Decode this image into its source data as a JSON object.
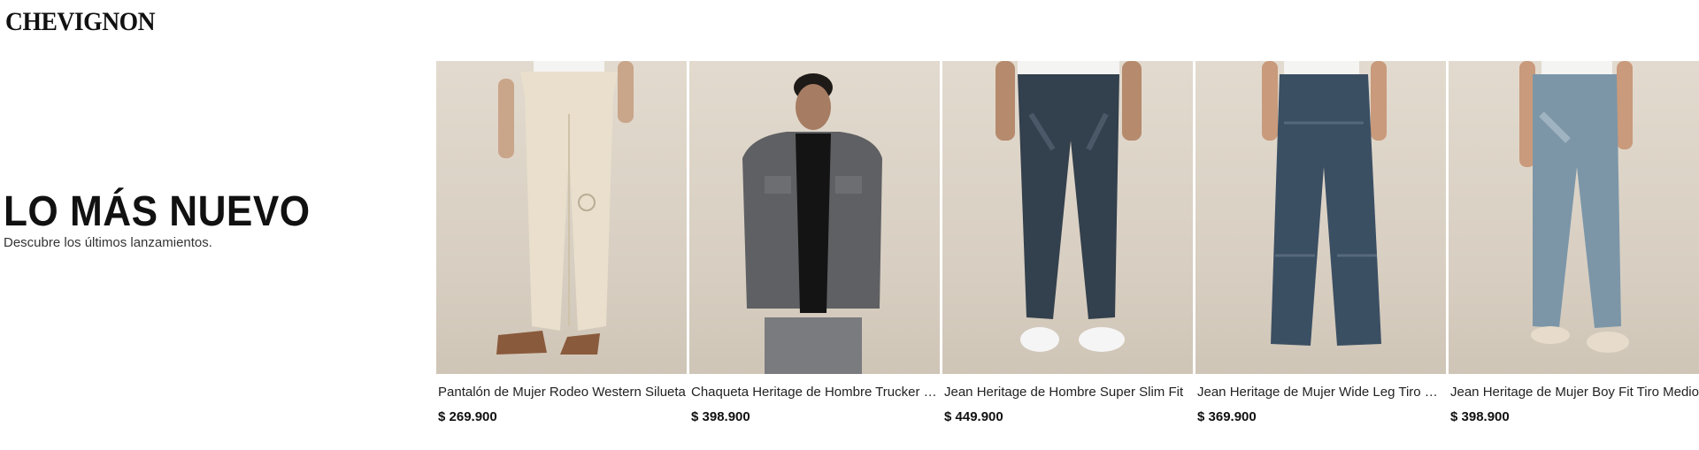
{
  "brand": {
    "logo_text": "CHEVIGNON"
  },
  "hero": {
    "title": "LO MÁS NUEVO",
    "subtitle": "Descubre los últimos lanzamientos."
  },
  "products": [
    {
      "name": "Pantalón de Mujer Rodeo Western Silueta",
      "price": "$ 269.900",
      "image": "beige-studded-pants-photo"
    },
    {
      "name": "Chaqueta Heritage de Hombre Trucker Jacket",
      "price": "$ 398.900",
      "image": "grey-denim-jacket-photo"
    },
    {
      "name": "Jean Heritage de Hombre Super Slim Fit",
      "price": "$ 449.900",
      "image": "dark-slim-jean-photo"
    },
    {
      "name": "Jean Heritage de Mujer Wide Leg Tiro Medio",
      "price": "$ 369.900",
      "image": "wide-leg-jean-photo"
    },
    {
      "name": "Jean Heritage de Mujer Boy Fit Tiro Medio",
      "price": "$ 398.900",
      "image": "boy-fit-jean-photo"
    }
  ]
}
